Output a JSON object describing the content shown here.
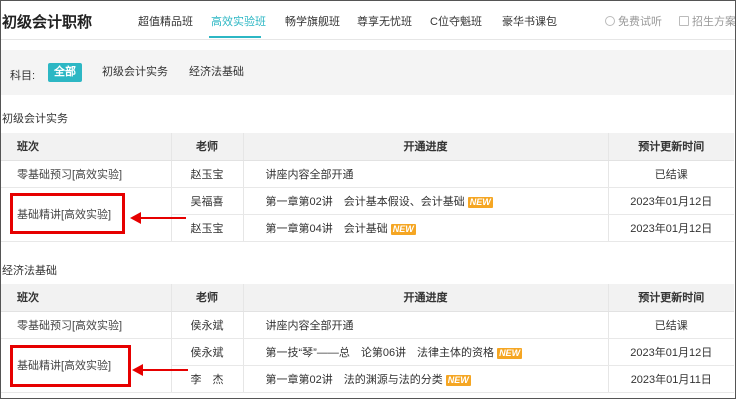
{
  "header": {
    "brand": "初级会计职称",
    "tabs": [
      {
        "label": "超值精品班"
      },
      {
        "label": "高效实验班"
      },
      {
        "label": "畅学旗舰班"
      },
      {
        "label": "尊享无忧班"
      },
      {
        "label": "C位夺魁班"
      },
      {
        "label": "豪华书课包"
      }
    ],
    "active_tab": "高效实验班",
    "free_trial": "免费试听",
    "enroll_plan": "招生方案"
  },
  "filter": {
    "label": "科目:",
    "options": [
      "全部",
      "初级会计实务",
      "经济法基础"
    ],
    "selected": "全部"
  },
  "columns": {
    "class": "班次",
    "teacher": "老师",
    "progress": "开通进度",
    "time": "预计更新时间"
  },
  "sections": [
    {
      "title": "初级会计实务",
      "rows": [
        {
          "class": "零基础预习[高效实验]",
          "teacher": "赵玉宝",
          "progress": "讲座内容全部开通",
          "new": "",
          "time": "已结课"
        },
        {
          "class": "基础精讲[高效实验]",
          "teacher": "吴福喜",
          "progress": "第一章第02讲　会计基本假设、会计基础",
          "new": "NEW",
          "time": "2023年01月12日"
        },
        {
          "class": "",
          "teacher": "赵玉宝",
          "progress": "第一章第04讲　会计基础",
          "new": "NEW",
          "time": "2023年01月12日"
        }
      ]
    },
    {
      "title": "经济法基础",
      "rows": [
        {
          "class": "零基础预习[高效实验]",
          "teacher": "侯永斌",
          "progress": "讲座内容全部开通",
          "new": "",
          "time": "已结课"
        },
        {
          "class": "基础精讲[高效实验]",
          "teacher": "侯永斌",
          "progress": "第一技“琴”——总　论第06讲　法律主体的资格",
          "new": "NEW",
          "time": "2023年01月12日"
        },
        {
          "class": "",
          "teacher": "李　杰",
          "progress": "第一章第02讲　法的渊源与法的分类",
          "new": "NEW",
          "time": "2023年01月11日"
        }
      ]
    }
  ],
  "colors": {
    "accent": "#2db7c4",
    "annotation": "#e60000",
    "new_badge": "#f5a623"
  }
}
